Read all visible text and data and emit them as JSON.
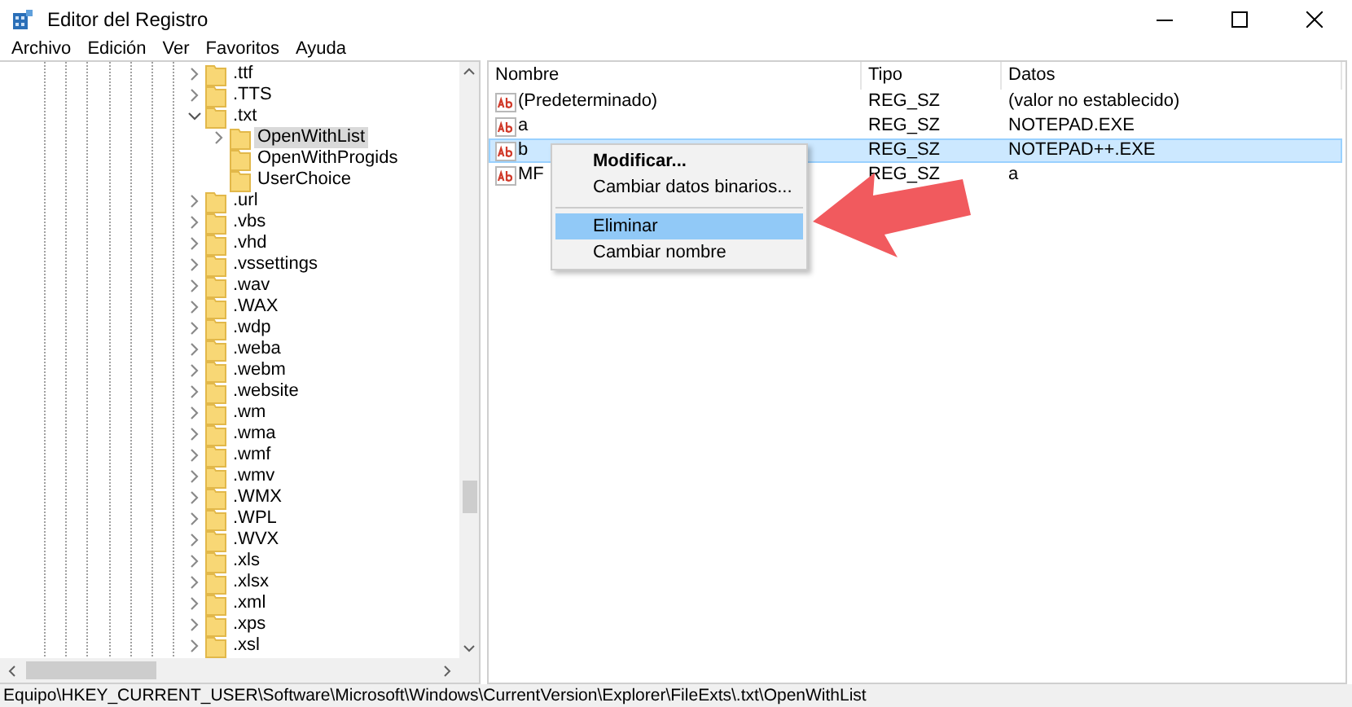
{
  "window": {
    "title": "Editor del Registro"
  },
  "menu_bar": [
    "Archivo",
    "Edición",
    "Ver",
    "Favoritos",
    "Ayuda"
  ],
  "tree": [
    {
      "label": ".ttf",
      "expanded": false,
      "selected": false
    },
    {
      "label": ".TTS",
      "expanded": false,
      "selected": false
    },
    {
      "label": ".txt",
      "expanded": true,
      "selected": false,
      "children": [
        {
          "label": "OpenWithList",
          "expanded": false,
          "selected": true
        },
        {
          "label": "OpenWithProgids",
          "selected": false
        },
        {
          "label": "UserChoice",
          "selected": false
        }
      ]
    },
    {
      "label": ".url",
      "expanded": false,
      "selected": false
    },
    {
      "label": ".vbs",
      "expanded": false,
      "selected": false
    },
    {
      "label": ".vhd",
      "expanded": false,
      "selected": false
    },
    {
      "label": ".vssettings",
      "expanded": false,
      "selected": false
    },
    {
      "label": ".wav",
      "expanded": false,
      "selected": false
    },
    {
      "label": ".WAX",
      "expanded": false,
      "selected": false
    },
    {
      "label": ".wdp",
      "expanded": false,
      "selected": false
    },
    {
      "label": ".weba",
      "expanded": false,
      "selected": false
    },
    {
      "label": ".webm",
      "expanded": false,
      "selected": false
    },
    {
      "label": ".website",
      "expanded": false,
      "selected": false
    },
    {
      "label": ".wm",
      "expanded": false,
      "selected": false
    },
    {
      "label": ".wma",
      "expanded": false,
      "selected": false
    },
    {
      "label": ".wmf",
      "expanded": false,
      "selected": false
    },
    {
      "label": ".wmv",
      "expanded": false,
      "selected": false
    },
    {
      "label": ".WMX",
      "expanded": false,
      "selected": false
    },
    {
      "label": ".WPL",
      "expanded": false,
      "selected": false
    },
    {
      "label": ".WVX",
      "expanded": false,
      "selected": false
    },
    {
      "label": ".xls",
      "expanded": false,
      "selected": false
    },
    {
      "label": ".xlsx",
      "expanded": false,
      "selected": false
    },
    {
      "label": ".xml",
      "expanded": false,
      "selected": false
    },
    {
      "label": ".xps",
      "expanded": false,
      "selected": false
    },
    {
      "label": ".xsl",
      "expanded": false,
      "selected": false
    }
  ],
  "values": {
    "columns": [
      "Nombre",
      "Tipo",
      "Datos"
    ],
    "rows": [
      {
        "name": "(Predeterminado)",
        "type": "REG_SZ",
        "data": "(valor no establecido)",
        "selected": false
      },
      {
        "name": "a",
        "type": "REG_SZ",
        "data": "NOTEPAD.EXE",
        "selected": false
      },
      {
        "name": "b",
        "type": "REG_SZ",
        "data": "NOTEPAD++.EXE",
        "selected": true
      },
      {
        "name": "MF",
        "type": "REG_SZ",
        "data": "a",
        "selected": false
      }
    ]
  },
  "context_menu": [
    {
      "kind": "item",
      "label": "Modificar...",
      "default": true,
      "selected": false
    },
    {
      "kind": "item",
      "label": "Cambiar datos binarios...",
      "default": false,
      "selected": false
    },
    {
      "kind": "separator"
    },
    {
      "kind": "item",
      "label": "Eliminar",
      "default": false,
      "selected": true
    },
    {
      "kind": "item",
      "label": "Cambiar nombre",
      "default": false,
      "selected": false
    }
  ],
  "status_bar": "Equipo\\HKEY_CURRENT_USER\\Software\\Microsoft\\Windows\\CurrentVersion\\Explorer\\FileExts\\.txt\\OpenWithList"
}
